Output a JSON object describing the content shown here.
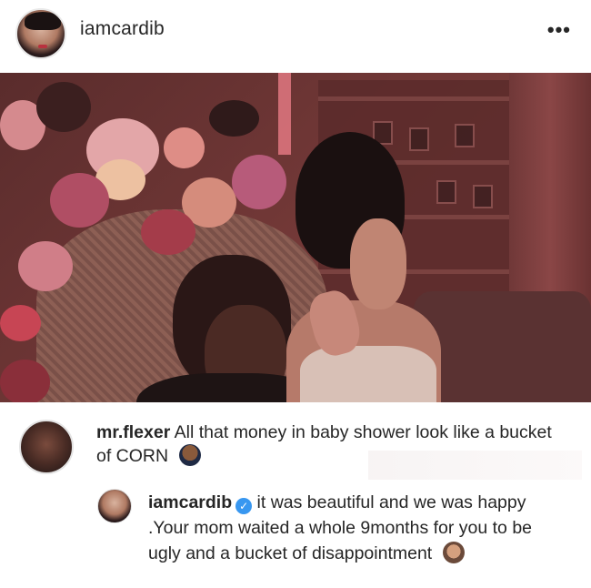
{
  "post": {
    "username": "iamcardib",
    "more_label": "•••"
  },
  "comments": [
    {
      "username": "mr.flexer",
      "text": "All that money in baby shower look like a bucket of CORN",
      "emoji": "man-emoji-icon"
    },
    {
      "username": "iamcardib",
      "verified": true,
      "text": "it was beautiful and we was happy .Your mom waited a whole 9months for you to be ugly and a bucket of disappointment",
      "emoji": "woman-tipping-hand-emoji-icon"
    }
  ],
  "colors": {
    "verified_blue": "#3897f0",
    "text": "#262626"
  }
}
